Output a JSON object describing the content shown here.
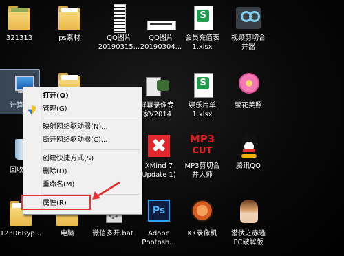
{
  "desktop": {
    "icons": [
      {
        "label1": "321313",
        "label2": ""
      },
      {
        "label1": "ps素材",
        "label2": ""
      },
      {
        "label1": "QQ图片",
        "label2": "20190315..."
      },
      {
        "label1": "QQ图片",
        "label2": "20190304..."
      },
      {
        "label1": "会员充值表",
        "label2": "1.xlsx"
      },
      {
        "label1": "视频剪切合",
        "label2": "并器"
      },
      {
        "label1": "计算机",
        "label2": ""
      },
      {
        "label1": "屏幕录像专",
        "label2": "家V2014"
      },
      {
        "label1": "娱乐片单",
        "label2": "1.xlsx"
      },
      {
        "label1": "萤花美照",
        "label2": ""
      },
      {
        "label1": "回收站",
        "label2": ""
      },
      {
        "label1": "XMind 7",
        "label2": "Update 1)"
      },
      {
        "label1": "MP3剪切合",
        "label2": "并大师"
      },
      {
        "label1": "腾讯QQ",
        "label2": ""
      },
      {
        "label1": "12306Byp...",
        "label2": ""
      },
      {
        "label1": "电脑",
        "label2": ""
      },
      {
        "label1": "微信多开.bat",
        "label2": ""
      },
      {
        "label1": "Adobe",
        "label2": "Photosh..."
      },
      {
        "label1": "KK录像机",
        "label2": ""
      },
      {
        "label1": "潜伏之赤途",
        "label2": "PC破解版"
      }
    ],
    "icon_text": {
      "mp3": "MP3",
      "cut": "CUT",
      "ps": "Ps",
      "xlsx": "S"
    }
  },
  "context_menu": {
    "items": [
      {
        "label": "打开(O)"
      },
      {
        "label": "管理(G)"
      },
      {
        "label": "映射网络驱动器(N)..."
      },
      {
        "label": "断开网络驱动器(C)..."
      },
      {
        "label": "创建快捷方式(S)"
      },
      {
        "label": "删除(D)"
      },
      {
        "label": "重命名(M)"
      },
      {
        "label": "属性(R)"
      }
    ]
  },
  "colors": {
    "highlight_box": "#e53434",
    "menu_bg": "#f0f0f0"
  }
}
